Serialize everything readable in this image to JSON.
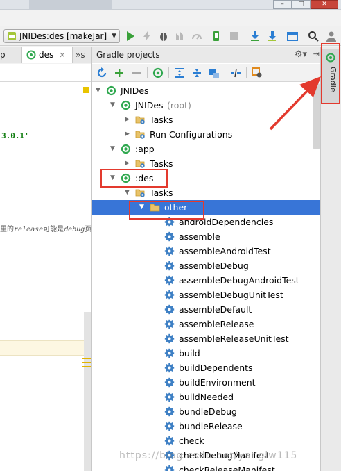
{
  "toolbar": {
    "run_config": "JNIDes:des [makeJar]",
    "icons": [
      "run-icon",
      "lightning-icon",
      "debug-icon",
      "coverage-icon",
      "profile-icon",
      "attach-icon",
      "stop-icon",
      "sync-gradle-icon",
      "sdk-manager-icon",
      "project-structure-icon",
      "search-icon",
      "user-icon"
    ]
  },
  "editor": {
    "tabs": [
      {
        "label": "p"
      },
      {
        "label": "des"
      },
      {
        "label": "»"
      }
    ],
    "more_tab_count": "s",
    "version_text": "3.0.1'",
    "comment_text": [
      "里的",
      "release",
      "可能是",
      "debug",
      "页"
    ]
  },
  "gradle_panel": {
    "title": "Gradle projects",
    "toolbar_icons": [
      "refresh-icon",
      "add-icon",
      "remove-icon",
      "execute-task-icon",
      "expand-all-icon",
      "collapse-all-icon",
      "group-icon",
      "toggle-offline-icon",
      "gradle-settings-icon"
    ],
    "tree": [
      {
        "label": "JNIDes",
        "level": 0,
        "expanded": true,
        "icon": "gradle-module-icon"
      },
      {
        "label": "JNIDes",
        "suffix": "(root)",
        "level": 1,
        "expanded": true,
        "icon": "gradle-module-icon"
      },
      {
        "label": "Tasks",
        "level": 2,
        "expanded": false,
        "icon": "task-folder-icon"
      },
      {
        "label": "Run Configurations",
        "level": 2,
        "expanded": false,
        "icon": "task-folder-icon"
      },
      {
        "label": ":app",
        "level": 1,
        "expanded": true,
        "icon": "gradle-module-icon"
      },
      {
        "label": "Tasks",
        "level": 2,
        "expanded": false,
        "icon": "task-folder-icon"
      },
      {
        "label": ":des",
        "level": 1,
        "expanded": true,
        "icon": "gradle-module-icon"
      },
      {
        "label": "Tasks",
        "level": 2,
        "expanded": true,
        "icon": "task-folder-icon"
      },
      {
        "label": "other",
        "level": 3,
        "expanded": true,
        "icon": "folder-icon",
        "selected": true
      },
      {
        "label": "androidDependencies",
        "level": 4,
        "icon": "gear-icon"
      },
      {
        "label": "assemble",
        "level": 4,
        "icon": "gear-icon"
      },
      {
        "label": "assembleAndroidTest",
        "level": 4,
        "icon": "gear-icon"
      },
      {
        "label": "assembleDebug",
        "level": 4,
        "icon": "gear-icon"
      },
      {
        "label": "assembleDebugAndroidTest",
        "level": 4,
        "icon": "gear-icon"
      },
      {
        "label": "assembleDebugUnitTest",
        "level": 4,
        "icon": "gear-icon"
      },
      {
        "label": "assembleDefault",
        "level": 4,
        "icon": "gear-icon"
      },
      {
        "label": "assembleRelease",
        "level": 4,
        "icon": "gear-icon"
      },
      {
        "label": "assembleReleaseUnitTest",
        "level": 4,
        "icon": "gear-icon"
      },
      {
        "label": "build",
        "level": 4,
        "icon": "gear-icon"
      },
      {
        "label": "buildDependents",
        "level": 4,
        "icon": "gear-icon"
      },
      {
        "label": "buildEnvironment",
        "level": 4,
        "icon": "gear-icon"
      },
      {
        "label": "buildNeeded",
        "level": 4,
        "icon": "gear-icon"
      },
      {
        "label": "bundleDebug",
        "level": 4,
        "icon": "gear-icon"
      },
      {
        "label": "bundleRelease",
        "level": 4,
        "icon": "gear-icon"
      },
      {
        "label": "check",
        "level": 4,
        "icon": "gear-icon"
      },
      {
        "label": "checkDebugManifest",
        "level": 4,
        "icon": "gear-icon"
      },
      {
        "label": "checkReleaseManifest",
        "level": 4,
        "icon": "gear-icon"
      }
    ]
  },
  "side_tool": {
    "label": "Gradle"
  },
  "watermark": "https://blog.csdn.net/yanglw115",
  "colors": {
    "selection": "#3875d7",
    "gradle_green": "#2fa84f",
    "annotation_red": "#e33a2e",
    "gear_blue": "#3d7fc4"
  }
}
